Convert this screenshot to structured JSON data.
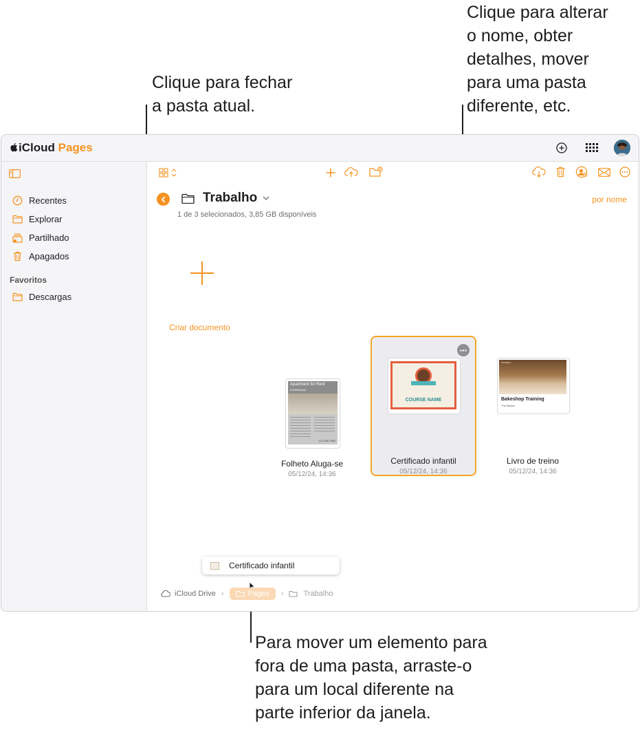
{
  "callouts": {
    "top_left": [
      "Clique para fechar",
      "a pasta atual."
    ],
    "top_right": [
      "Clique para alterar",
      "o nome, obter",
      "detalhes, mover",
      "para uma pasta",
      "diferente, etc."
    ],
    "bottom": [
      "Para mover um elemento para",
      "fora de uma pasta, arraste-o",
      "para um local diferente na",
      "parte inferior da janela."
    ]
  },
  "app": {
    "brand_prefix": "iCloud",
    "brand_name": "Pages",
    "accent": "#f5921f"
  },
  "sidebar": {
    "items": [
      {
        "label": "Recentes",
        "icon": "clock-icon"
      },
      {
        "label": "Explorar",
        "icon": "folder-icon"
      },
      {
        "label": "Partilhado",
        "icon": "shared-folder-icon"
      },
      {
        "label": "Apagados",
        "icon": "trash-icon"
      }
    ],
    "favorites_heading": "Favoritos",
    "favorites": [
      {
        "label": "Descargas",
        "icon": "folder-icon"
      }
    ]
  },
  "folder": {
    "title": "Trabalho",
    "subtitle": "1 de 3 selecionados, 3,85 GB disponíveis",
    "sort_label": "por nome"
  },
  "create": {
    "label": "Criar documento"
  },
  "documents": [
    {
      "name": "Folheto Aluga-se",
      "date": "05/12/24, 14:36",
      "thumb_title": "Apartment for Rent",
      "thumb_price": "$1400/Month",
      "thumb_phone": "123.456.7890"
    },
    {
      "name": "Certificado infantil",
      "date": "05/12/24, 14:36",
      "thumb_title": "COURSE NAME",
      "selected": true
    },
    {
      "name": "Livro de treino",
      "date": "05/12/24, 14:36",
      "thumb_title": "Bakeshop Training",
      "thumb_subtitle": "The Basics",
      "thumb_badge": "3rd Edition"
    }
  ],
  "drag_item": {
    "label": "Certificado infantil"
  },
  "breadcrumb": [
    "iCloud Drive",
    "Pages",
    "Trabalho"
  ]
}
